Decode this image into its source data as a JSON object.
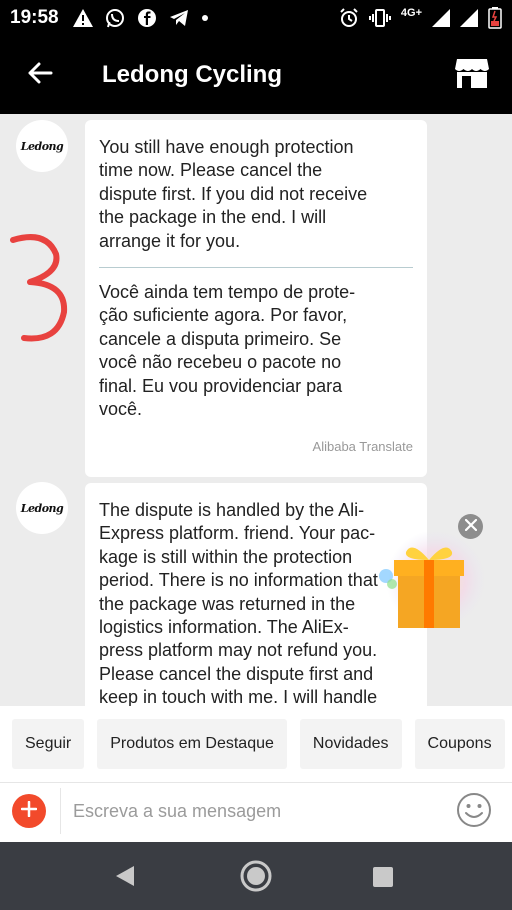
{
  "status_bar": {
    "time": "19:58",
    "network": "4G+"
  },
  "header": {
    "title": "Ledong Cycling"
  },
  "messages": [
    {
      "sender_logo": "Ledong",
      "lines_en": [
        "You still have enough protection",
        "time now. Please cancel the",
        "dispute first. If you did not receive",
        "the package in the end. I will",
        "arrange it for you."
      ],
      "lines_pt": [
        "Você ainda tem tempo de prote-",
        "ção suficiente agora. Por favor,",
        "cancele a disputa primeiro. Se",
        "você não recebeu o pacote no",
        "final. Eu vou providenciar para",
        "você."
      ],
      "translate_credit": "Alibaba Translate"
    },
    {
      "sender_logo": "Ledong",
      "lines_en": [
        "The dispute is handled by the Ali-",
        "Express platform. friend. Your pac-",
        "kage is still within the protection",
        "period. There is no information that",
        "the package was returned in the",
        "logistics information. The AliEx-",
        "press platform may not refund you.",
        "Please cancel the dispute first and",
        "keep in touch with me. I will handle"
      ]
    }
  ],
  "quick_replies": [
    "Seguir",
    "Produtos em Destaque",
    "Novidades",
    "Coupons"
  ],
  "input": {
    "placeholder": "Escreva a sua mensagem"
  },
  "colors": {
    "accent": "#f24a2b",
    "annotation": "#e8423f",
    "header": "#000000"
  }
}
